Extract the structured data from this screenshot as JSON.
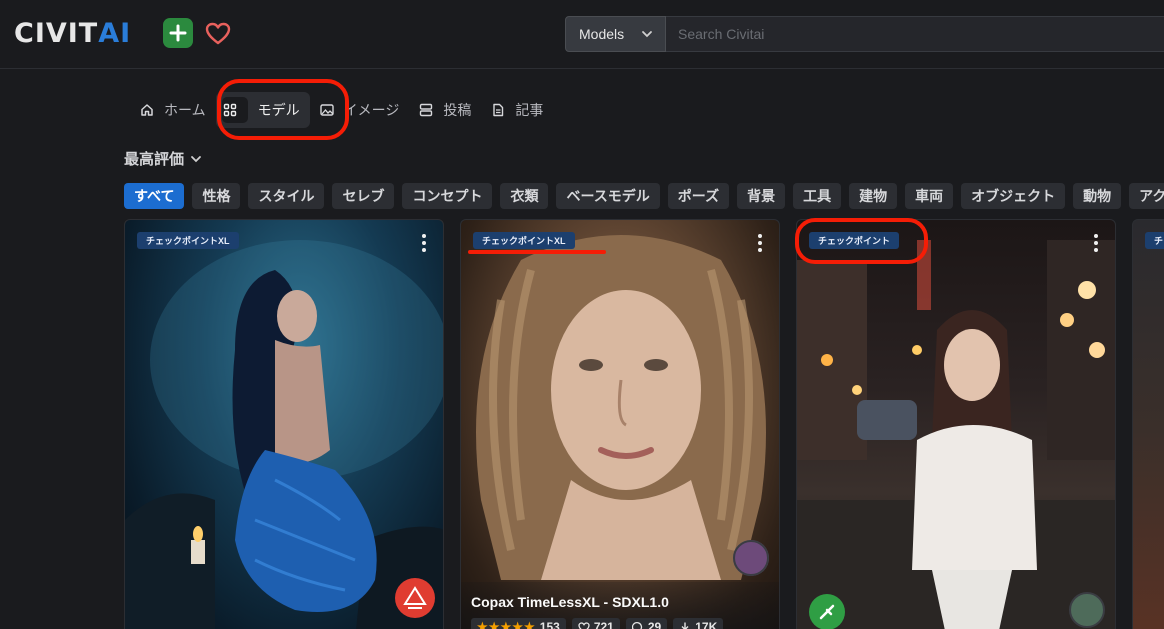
{
  "header": {
    "logo_civit": "CIVIT",
    "logo_ai": "AI",
    "search": {
      "category": "Models",
      "placeholder": "Search Civitai"
    }
  },
  "nav": {
    "items": [
      {
        "label": "ホーム",
        "icon": "home-icon"
      },
      {
        "label": "モデル",
        "icon": "grid-icon"
      },
      {
        "label": "イメージ",
        "icon": "image-icon"
      },
      {
        "label": "投稿",
        "icon": "posts-icon"
      },
      {
        "label": "記事",
        "icon": "article-icon"
      }
    ]
  },
  "sort": {
    "label": "最高評価"
  },
  "chips": [
    "すべて",
    "性格",
    "スタイル",
    "セレブ",
    "コンセプト",
    "衣類",
    "ベースモデル",
    "ポーズ",
    "背景",
    "工具",
    "建物",
    "車両",
    "オブジェクト",
    "動物",
    "アクション"
  ],
  "cards": [
    {
      "badge": "チェックポイントXL"
    },
    {
      "badge": "チェックポイントXL",
      "title": "Copax TimeLessXL - SDXL1.0",
      "rating_count": "153",
      "likes": "721",
      "comments": "29",
      "downloads": "17K"
    },
    {
      "badge": "チェックポイント"
    },
    {
      "badge": "チ"
    }
  ],
  "colors": {
    "accent": "#1c6dd0",
    "annotation": "#f51d06",
    "plus_green": "#2b8a3e",
    "heart_red": "#e8615d"
  }
}
